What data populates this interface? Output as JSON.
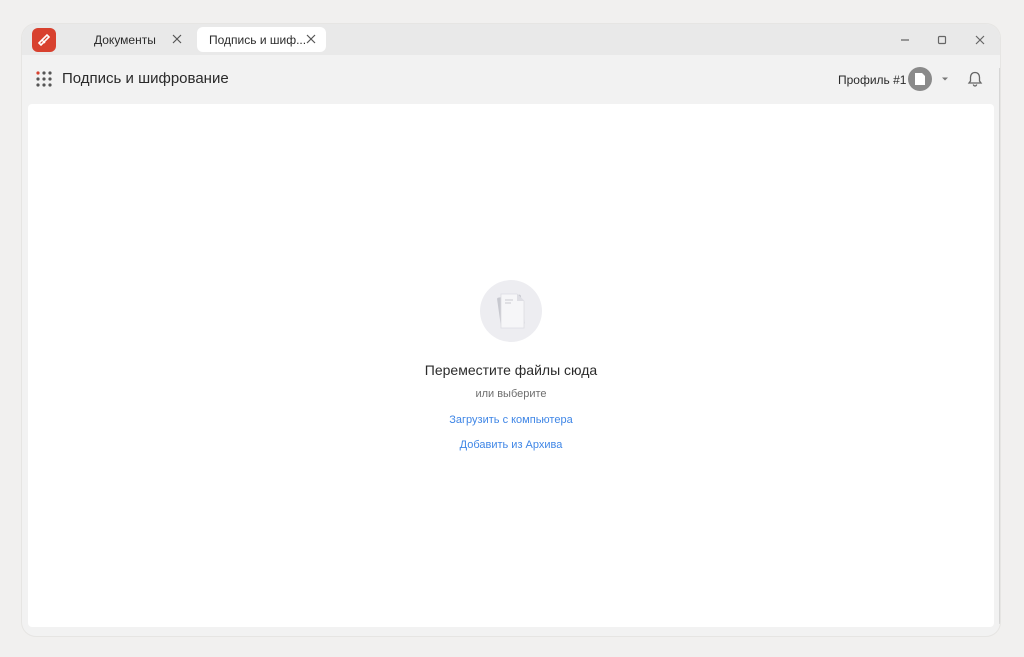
{
  "tabs": [
    {
      "label": "Документы",
      "active": false
    },
    {
      "label": "Подпись и шиф...",
      "active": true
    }
  ],
  "header": {
    "title": "Подпись и шифрование",
    "profile_name": "Профиль #1"
  },
  "drop_zone": {
    "title": "Переместите файлы сюда",
    "or_text": "или выберите",
    "upload_link": "Загрузить с компьютера",
    "archive_link": "Добавить из Архива"
  },
  "colors": {
    "brand": "#d8412f",
    "link": "#3f86e6",
    "avatar": "#8a8a8a"
  },
  "icons": [
    "app-logo-icon",
    "close-icon",
    "minimize-icon",
    "maximize-icon",
    "grid-icon",
    "avatar-icon",
    "chevron-down-icon",
    "bell-icon",
    "documents-icon"
  ]
}
